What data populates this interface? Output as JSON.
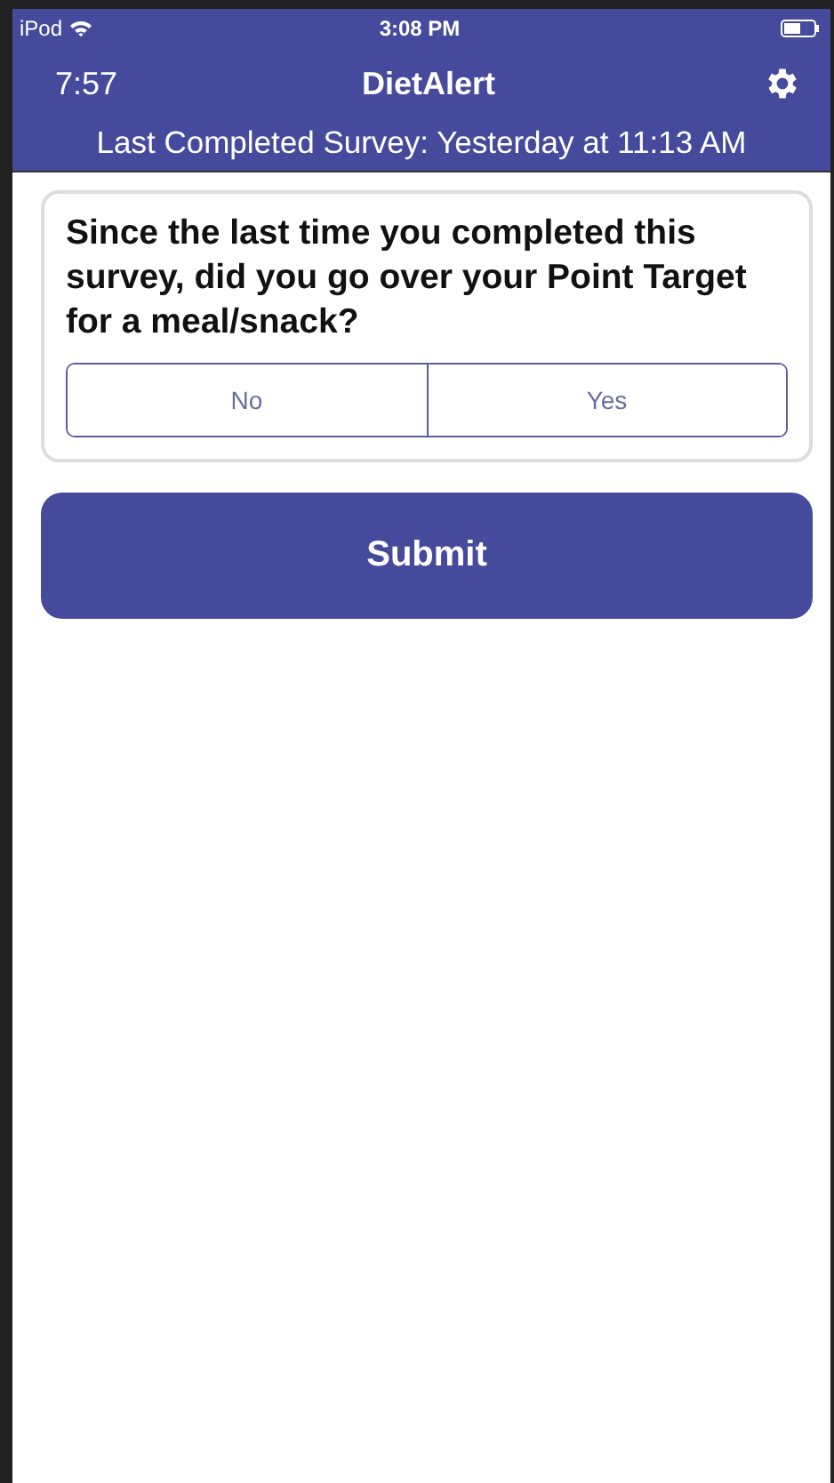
{
  "status_bar": {
    "carrier": "iPod",
    "time": "3:08 PM"
  },
  "nav_bar": {
    "timer": "7:57",
    "title": "DietAlert"
  },
  "last_survey": "Last Completed Survey: Yesterday at 11:13 AM",
  "question": {
    "text": "Since the last time you completed this survey, did you go over your Point Target for a meal/snack?",
    "options": [
      {
        "label": "No",
        "selected": false
      },
      {
        "label": "Yes",
        "selected": false
      }
    ]
  },
  "submit": "Submit"
}
